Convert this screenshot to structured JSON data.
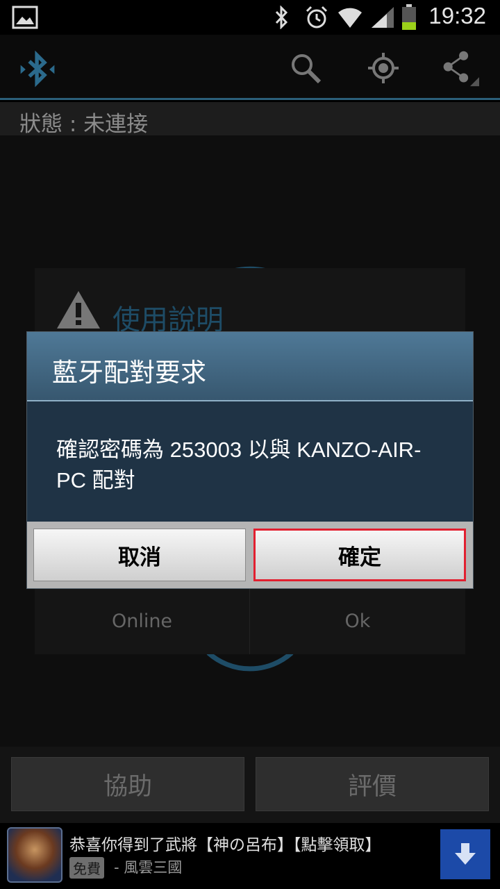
{
  "status_bar": {
    "time": "19:32",
    "icons": [
      "image-icon",
      "bluetooth-icon",
      "alarm-icon",
      "wifi-icon",
      "signal-icon",
      "battery-icon"
    ]
  },
  "action_bar": {
    "icons": [
      "bluetooth-logo-icon",
      "search-icon",
      "locate-icon",
      "share-icon"
    ],
    "accent": "#2b6a8c"
  },
  "status_row": {
    "text": "狀態 : 未連接"
  },
  "help_panel": {
    "title": "使用說明",
    "buttons": [
      "Online",
      "Ok"
    ]
  },
  "dialog": {
    "title": "藍牙配對要求",
    "message": "確認密碼為 253003 以與 KANZO-AIR-PC 配對",
    "cancel_label": "取消",
    "ok_label": "確定",
    "highlight_color": "#e22030"
  },
  "bottom_buttons": {
    "help_label": "協助",
    "rate_label": "評價"
  },
  "ad": {
    "title": "恭喜你得到了武將【神の呂布】【點擊領取】",
    "free_badge": "免費",
    "source": "- 風雲三國"
  }
}
